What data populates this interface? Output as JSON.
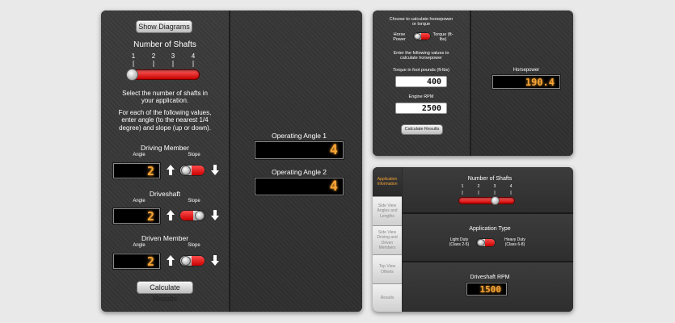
{
  "main_panel": {
    "show_diagrams_label": "Show Diagrams",
    "number_of_shafts_title": "Number of Shafts",
    "shaft_ticks": [
      "1",
      "2",
      "3",
      "4"
    ],
    "shafts_value": 1,
    "instruction_1": "Select the number of shafts in your application.",
    "instruction_2": "For each of the following values, enter angle (to the nearest 1/4 degree) and slope (up or down).",
    "members": [
      {
        "title": "Driving Member",
        "angle_label": "Angle",
        "slope_label": "Slope",
        "angle": "2"
      },
      {
        "title": "Driveshaft",
        "angle_label": "Angle",
        "slope_label": "Slope",
        "angle": "2"
      },
      {
        "title": "Driven Member",
        "angle_label": "Angle",
        "slope_label": "Slope",
        "angle": "2"
      }
    ],
    "calculate_label": "Calculate Results",
    "results": [
      {
        "label": "Operating Angle 1",
        "value": "4"
      },
      {
        "label": "Operating Angle 2",
        "value": "4"
      }
    ]
  },
  "hp_panel": {
    "choose_text": "Choose to calculate horsepower or torque",
    "horse_power_label": "Horse Power",
    "torque_label": "Torque (ft-lbs)",
    "enter_text": "Enter the following values to calculate horsepower",
    "torque_input_label": "Torque in foot pounds (ft-lbs)",
    "torque_value": "400",
    "rpm_label": "Engine RPM",
    "rpm_value": "2500",
    "calculate_label": "Calculate Results",
    "result_label": "Horsepower",
    "result_value": "190.4"
  },
  "tabbed_panel": {
    "tabs": [
      "Application Information",
      "Side View Angles and Lengths",
      "Side View Driving and Driven Members",
      "Top View Offsets",
      "Results"
    ],
    "shafts_title": "Number of Shafts",
    "shaft_ticks": [
      "1",
      "2",
      "3",
      "4"
    ],
    "shafts_value": 3,
    "app_type_title": "Application Type",
    "light_duty": "Light Duty (Class 2-5)",
    "heavy_duty": "Heavy Duty (Class 6-8)",
    "rpm_title": "Driveshaft RPM",
    "rpm_value": "1500"
  },
  "colors": {
    "accent_orange": "#f7a434",
    "toggle_red": "#d40000"
  }
}
